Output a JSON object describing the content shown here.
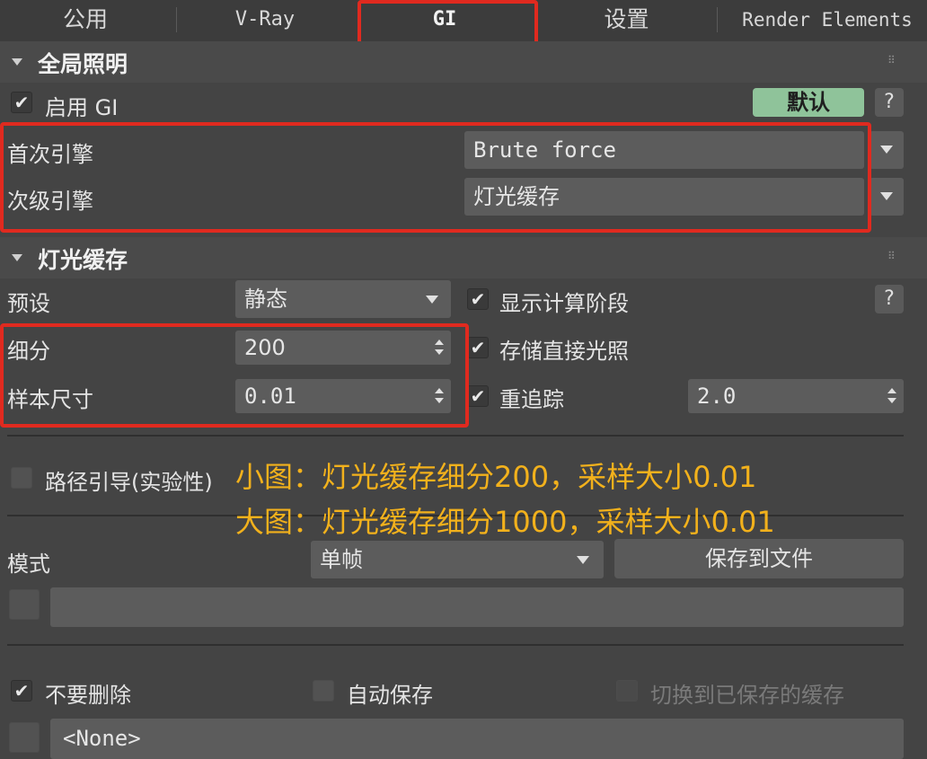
{
  "tabs": [
    {
      "label": "公用"
    },
    {
      "label": "V-Ray"
    },
    {
      "label": "GI"
    },
    {
      "label": "设置"
    },
    {
      "label": "Render Elements"
    }
  ],
  "gi_panel": {
    "title": "全局照明",
    "enable_gi": {
      "label": "启用 GI",
      "checked": true
    },
    "default_button": "默认",
    "help": "?",
    "primary_engine": {
      "label": "首次引擎",
      "value": "Brute force"
    },
    "secondary_engine": {
      "label": "次级引擎",
      "value": "灯光缓存"
    }
  },
  "light_cache_panel": {
    "title": "灯光缓存",
    "preset": {
      "label": "预设",
      "value": "静态"
    },
    "show_calc_phase": {
      "label": "显示计算阶段",
      "checked": true
    },
    "help": "?",
    "subdivs": {
      "label": "细分",
      "value": "200"
    },
    "store_direct_light": {
      "label": "存储直接光照",
      "checked": true
    },
    "sample_size": {
      "label": "样本尺寸",
      "value": "0.01"
    },
    "retrace": {
      "label": "重追踪",
      "checked": true,
      "value": "2.0"
    },
    "path_guiding": {
      "label": "路径引导(实验性)",
      "checked": false
    },
    "mode": {
      "label": "模式",
      "value": "单帧"
    },
    "save_to_file": "保存到文件",
    "dont_delete": {
      "label": "不要删除",
      "checked": true
    },
    "auto_save": {
      "label": "自动保存",
      "checked": false
    },
    "switch_to_saved": {
      "label": "切换到已保存的缓存",
      "checked": false
    },
    "file_field": "<None>"
  },
  "annotation": {
    "line1": "小图：灯光缓存细分200，采样大小0.01",
    "line2": "大图：灯光缓存细分1000，采样大小0.01",
    "color": "#f2b11c"
  },
  "colors": {
    "highlight_box": "#e02a1f",
    "default_button_bg": "#8fc39a"
  }
}
